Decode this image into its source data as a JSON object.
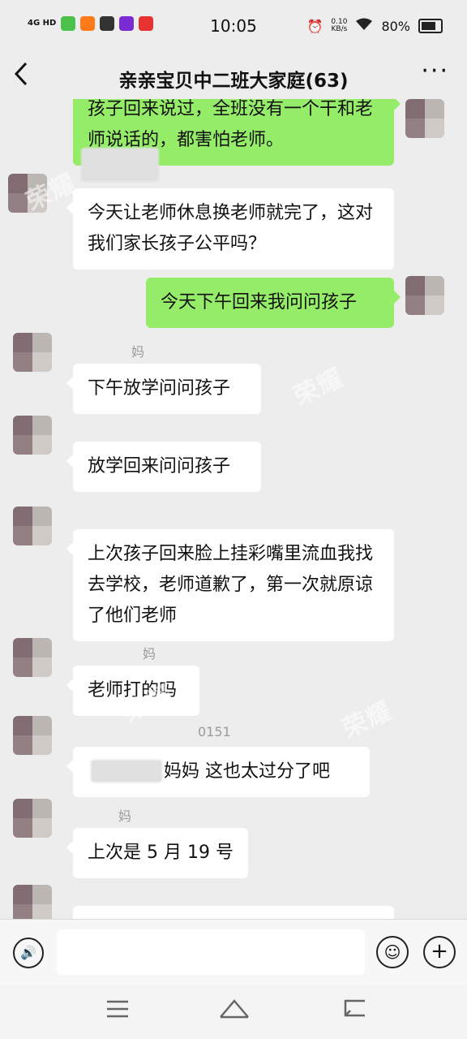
{
  "status_bar": {
    "signal": "4G HD",
    "time": "10:05",
    "net_speed_value": "0.10",
    "net_speed_unit": "KB/s",
    "battery": "80%"
  },
  "header": {
    "title": "亲亲宝贝中二班大家庭(63)",
    "back_icon": "chevron-left-icon",
    "more_icon": "more-dots-icon"
  },
  "messages": [
    {
      "side": "out",
      "text": "孩子回来说过，全班没有一个干和老师说话的，都害怕老师。"
    },
    {
      "side": "in",
      "nickname": "",
      "text": "今天让老师休息换老师就完了，这对我们家长孩子公平吗？"
    },
    {
      "side": "out",
      "text": "今天下午回来我问问孩子"
    },
    {
      "side": "in",
      "nickname": "妈",
      "text": "下午放学问问孩子"
    },
    {
      "side": "in",
      "nickname": "",
      "text": "放学回来问问孩子"
    },
    {
      "side": "in",
      "nickname": "",
      "text": "上次孩子回来脸上挂彩嘴里流血我找去学校，老师道歉了，第一次就原谅了他们老师"
    },
    {
      "side": "in",
      "nickname": "妈",
      "text": "老师打的吗"
    },
    {
      "side": "in",
      "nickname": "0151",
      "text": "妈妈  这也太过分了吧"
    },
    {
      "side": "in",
      "nickname": "妈",
      "text": "上次是 5 月 19 号"
    }
  ],
  "input_bar": {
    "voice_icon": "voice-icon",
    "emoji_icon": "emoji-icon",
    "plus_icon": "plus-icon"
  },
  "nav_bar": {
    "menu_icon": "menu-icon",
    "home_icon": "home-icon",
    "back_icon": "back-icon"
  },
  "colors": {
    "background": "#ededed",
    "outgoing_bubble": "#95ec69",
    "incoming_bubble": "#ffffff"
  }
}
